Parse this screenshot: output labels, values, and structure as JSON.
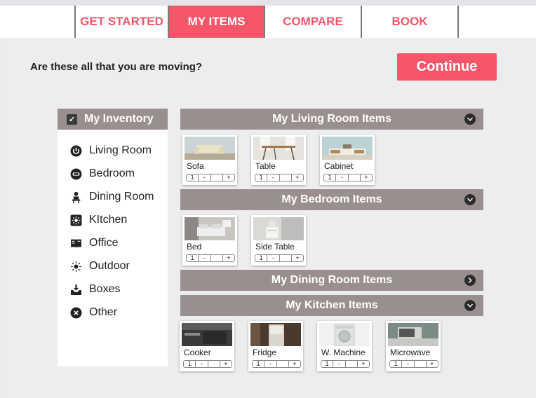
{
  "nav": {
    "tabs": [
      {
        "label": "GET STARTED",
        "active": false
      },
      {
        "label": "MY ITEMS",
        "active": true
      },
      {
        "label": "COMPARE",
        "active": false
      },
      {
        "label": "BOOK",
        "active": false
      }
    ]
  },
  "question": "Are these all that you are moving?",
  "continue_label": "Continue",
  "inventory": {
    "header": "My Inventory",
    "items": [
      {
        "label": "Living Room",
        "icon": "power-icon"
      },
      {
        "label": "Bedroom",
        "icon": "bed-icon"
      },
      {
        "label": "Dining Room",
        "icon": "dining-icon"
      },
      {
        "label": "KItchen",
        "icon": "kitchen-icon"
      },
      {
        "label": "Office",
        "icon": "book-icon"
      },
      {
        "label": "Outdoor",
        "icon": "sun-icon"
      },
      {
        "label": "Boxes",
        "icon": "box-icon"
      },
      {
        "label": "Other",
        "icon": "close-circle-icon"
      }
    ]
  },
  "sections": {
    "living": {
      "title": "My Living Room Items",
      "items": [
        {
          "name": "Sofa",
          "qty": "1",
          "minus": "-",
          "plus": "+"
        },
        {
          "name": "Table",
          "qty": "1",
          "minus": "-",
          "plus": "+"
        },
        {
          "name": "Cabinet",
          "qty": "1",
          "minus": "-",
          "plus": "+"
        }
      ]
    },
    "bedroom": {
      "title": "My Bedroom Items",
      "items": [
        {
          "name": "Bed",
          "qty": "1",
          "minus": "-",
          "plus": "+"
        },
        {
          "name": "Side Table",
          "qty": "1",
          "minus": "-",
          "plus": "+"
        }
      ]
    },
    "dining": {
      "title": "My Dining Room Items"
    },
    "kitchen": {
      "title": "My Kitchen Items",
      "items": [
        {
          "name": "Cooker",
          "qty": "1",
          "minus": "-",
          "plus": "+"
        },
        {
          "name": "Fridge",
          "qty": "1",
          "minus": "-",
          "plus": "+"
        },
        {
          "name": "W. Machine",
          "qty": "1",
          "minus": "-",
          "plus": "+"
        },
        {
          "name": "Microwave",
          "qty": "1",
          "minus": "-",
          "plus": "+"
        }
      ]
    }
  },
  "colors": {
    "accent": "#f5566a",
    "section_bar": "#9a8f8f",
    "panel": "#ededed"
  }
}
